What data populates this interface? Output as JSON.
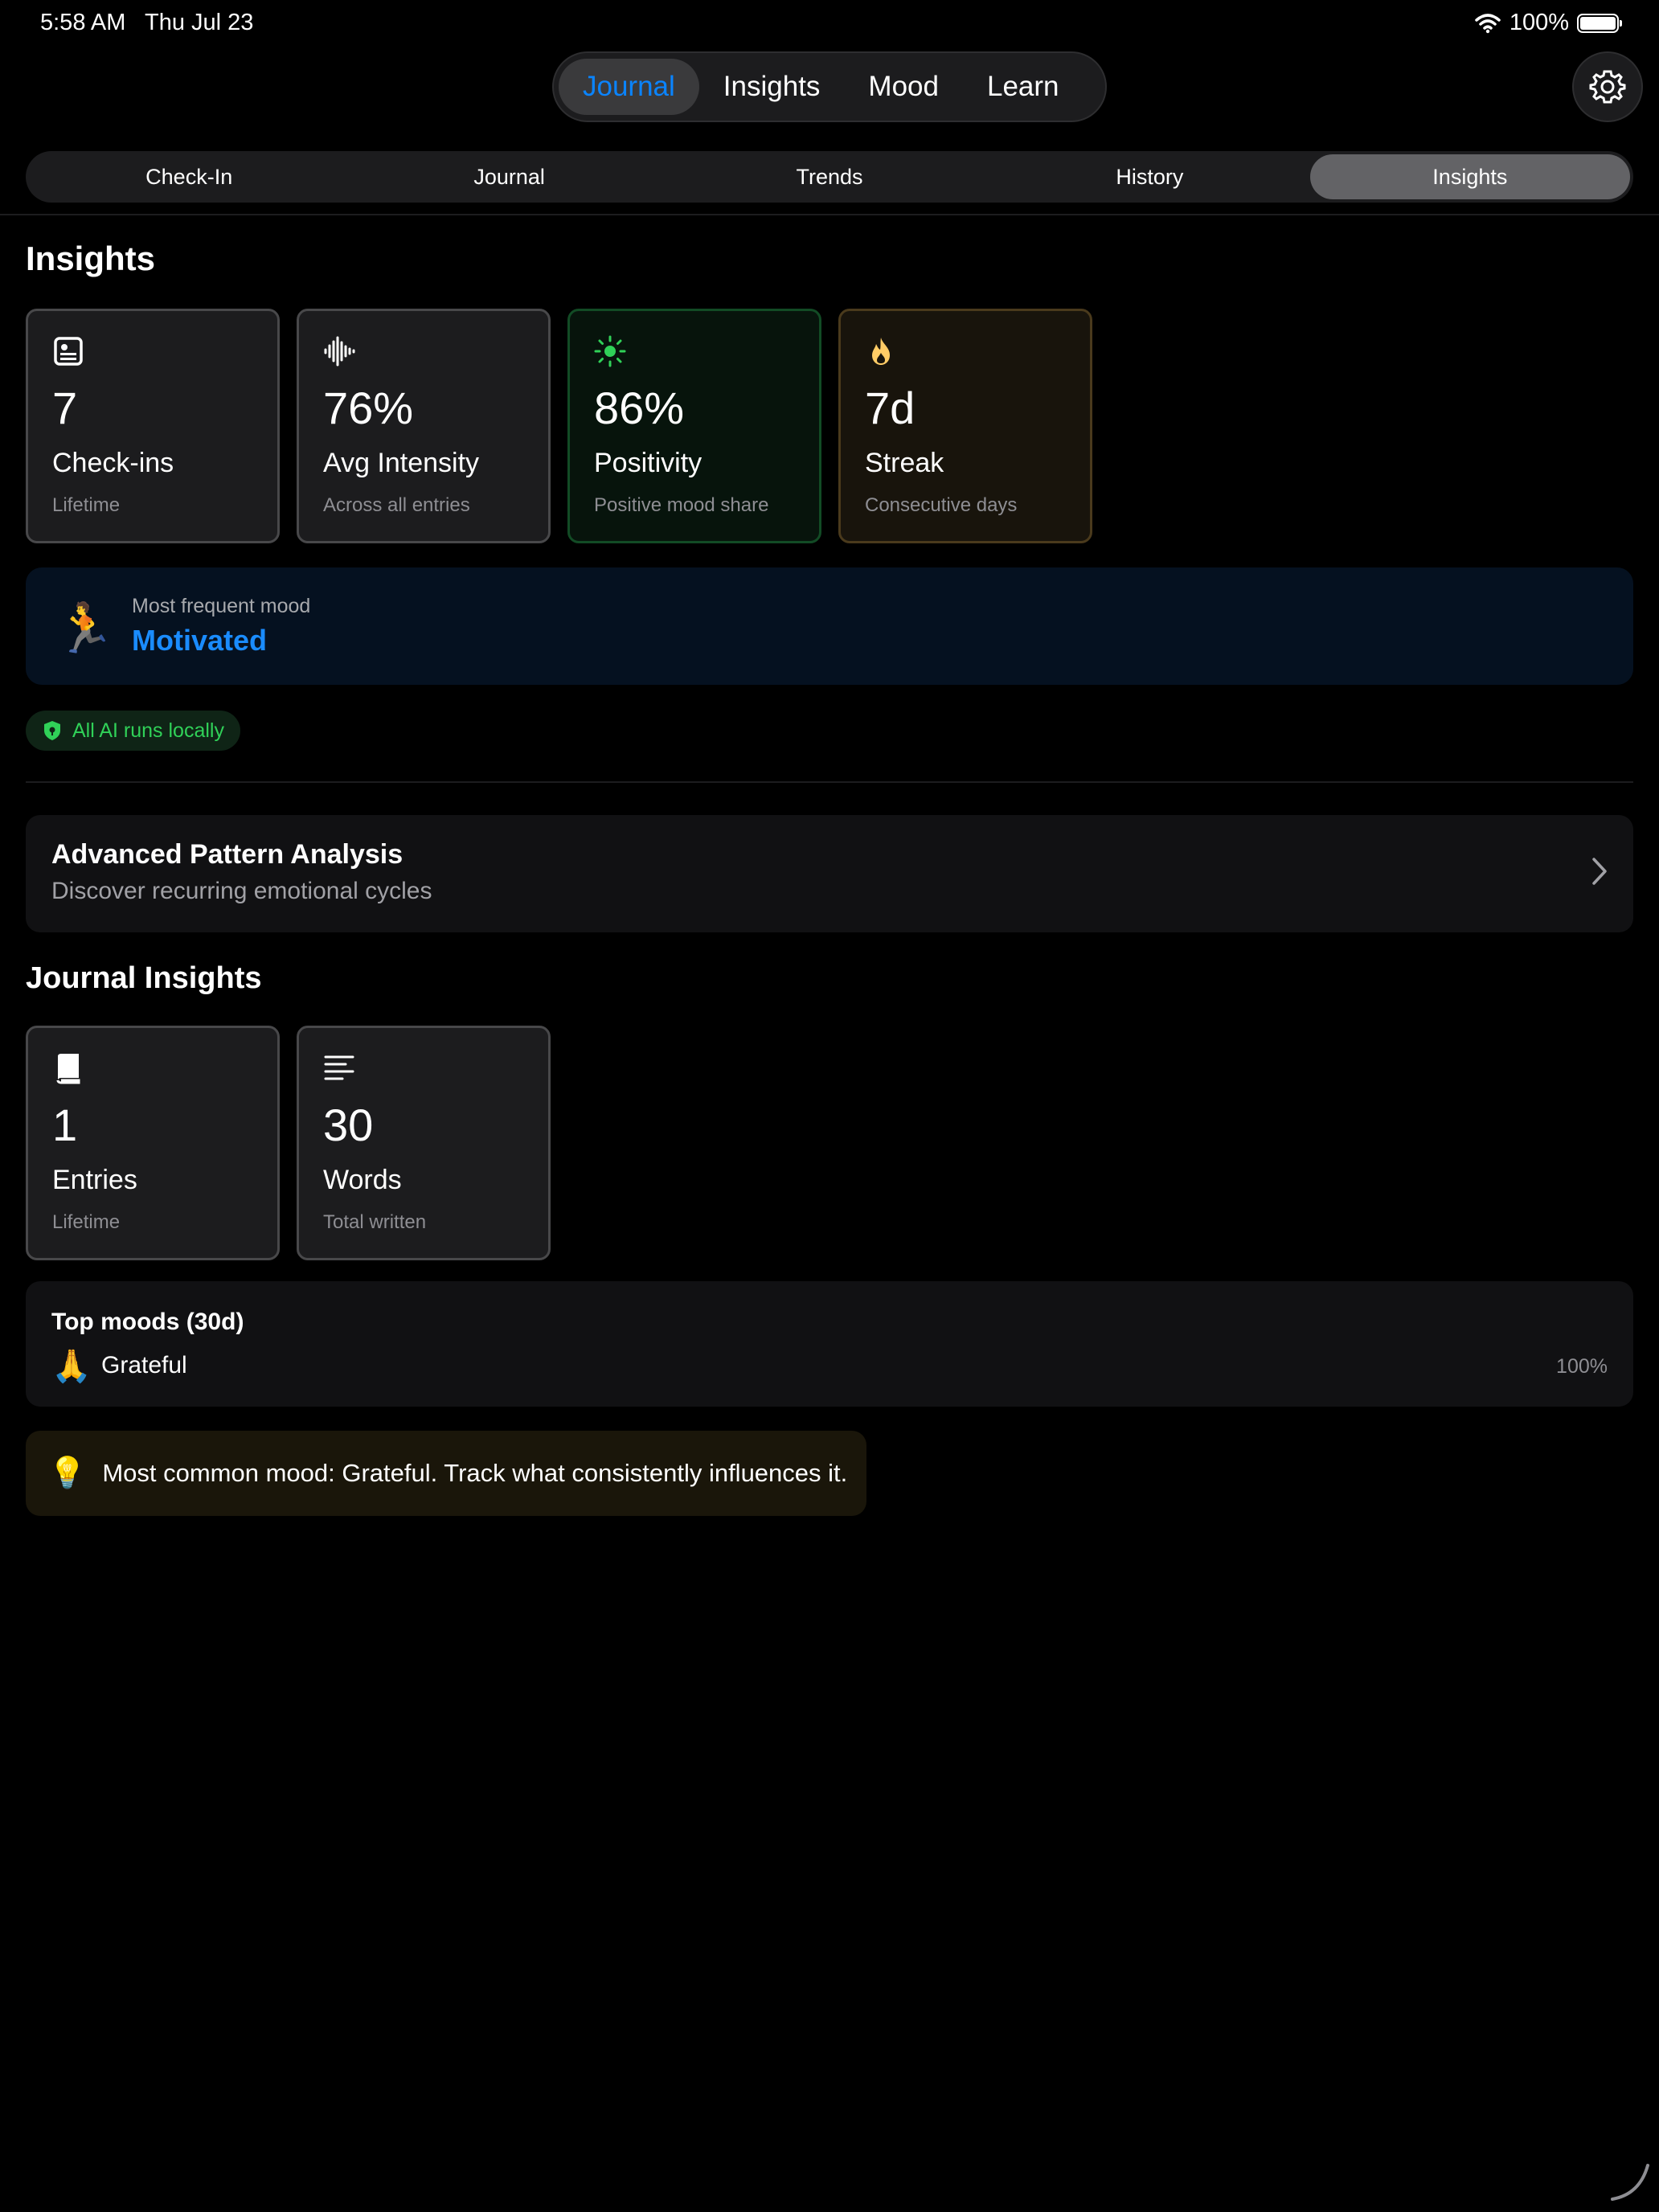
{
  "status": {
    "time": "5:58 AM",
    "date": "Thu Jul 23",
    "battery": "100%"
  },
  "topnav": {
    "items": [
      {
        "label": "Journal",
        "active": true
      },
      {
        "label": "Insights",
        "active": false
      },
      {
        "label": "Mood",
        "active": false
      },
      {
        "label": "Learn",
        "active": false
      }
    ]
  },
  "subtabs": {
    "items": [
      {
        "label": "Check-In",
        "active": false
      },
      {
        "label": "Journal",
        "active": false
      },
      {
        "label": "Trends",
        "active": false
      },
      {
        "label": "History",
        "active": false
      },
      {
        "label": "Insights",
        "active": true
      }
    ]
  },
  "insights": {
    "title": "Insights",
    "cards": [
      {
        "icon": "person-card-icon",
        "value": "7",
        "label": "Check-ins",
        "sub": "Lifetime",
        "tone": "neutral"
      },
      {
        "icon": "waveform-icon",
        "value": "76%",
        "label": "Avg Intensity",
        "sub": "Across all entries",
        "tone": "neutral"
      },
      {
        "icon": "sun-icon",
        "value": "86%",
        "label": "Positivity",
        "sub": "Positive mood share",
        "tone": "green"
      },
      {
        "icon": "flame-icon",
        "value": "7d",
        "label": "Streak",
        "sub": "Consecutive days",
        "tone": "amber"
      }
    ],
    "most_frequent": {
      "caption": "Most frequent mood",
      "value": "Motivated",
      "emoji": "🏃"
    },
    "ai_badge": "All AI runs locally",
    "advanced": {
      "title": "Advanced Pattern Analysis",
      "subtitle": "Discover recurring emotional cycles"
    }
  },
  "journal_insights": {
    "title": "Journal Insights",
    "cards": [
      {
        "icon": "book-icon",
        "value": "1",
        "label": "Entries",
        "sub": "Lifetime"
      },
      {
        "icon": "text-lines-icon",
        "value": "30",
        "label": "Words",
        "sub": "Total written"
      }
    ],
    "top_moods": {
      "title": "Top moods (30d)",
      "items": [
        {
          "emoji": "🙏",
          "name": "Grateful",
          "percent": "100%"
        }
      ]
    },
    "tip": {
      "emoji": "💡",
      "text": "Most common mood: Grateful. Track what consistently influences it."
    }
  },
  "colors": {
    "accent": "#0a84ff",
    "green": "#30d158",
    "amber": "#ffcc66"
  }
}
